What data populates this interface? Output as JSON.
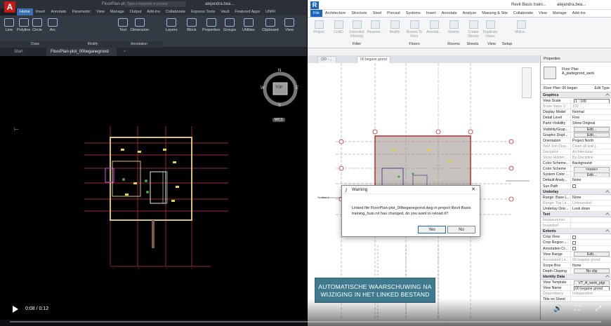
{
  "autocad": {
    "logo": "A",
    "filename": "FloorPlan-pl...",
    "search_placeholder": "Type a keyword or phrase",
    "user": "alejandra.bea...",
    "tabs": [
      "Home",
      "Insert",
      "Annotate",
      "Parametric",
      "View",
      "Manage",
      "Output",
      "Add-ins",
      "Collaborate",
      "Express Tools",
      "Vault",
      "Featured Apps",
      "UNIFI"
    ],
    "ribbon_tools": [
      "Line",
      "Polyline",
      "Circle",
      "Arc",
      "Text",
      "Dimension",
      "Layers",
      "Block",
      "Properties",
      "Groups",
      "Utilities",
      "Clipboard",
      "View"
    ],
    "ribbon_groups": [
      "Draw",
      "Modify",
      "Annotation"
    ],
    "doc_tabs": [
      "Start",
      "FloorPlan-plot_00beganegrond"
    ],
    "viewcube": {
      "top": "TOP",
      "n": "N",
      "s": "S",
      "e": "E",
      "w": "W"
    },
    "wcs": "WCS"
  },
  "revit": {
    "logo": "R",
    "title": "Revit Basis traini...",
    "user": "alejandra.bea...",
    "tabs": [
      "File",
      "Architecture",
      "Structure",
      "Steel",
      "Precast",
      "Systems",
      "Insert",
      "Annotate",
      "Analyze",
      "Massing & Site",
      "Collaborate",
      "View",
      "Manage",
      "Add-Ins"
    ],
    "ribbon_buttons": [
      "Project",
      "CoilID",
      "Extended Filtering",
      "Paramet...",
      "Modify",
      "Rooms To Floor",
      "Annotat...",
      "Rooms",
      "Create Sheets",
      "Duplicate Views",
      "Midco..."
    ],
    "ribbon_groups": [
      "Filter",
      "Floors",
      "Rooms",
      "Sheets",
      "View",
      "Setup"
    ],
    "doc_tabs": [
      "{3D - ...",
      "00 begane grond"
    ],
    "section_label": "Section 1",
    "properties": {
      "header": "Properties",
      "type_name": "Floor Plan",
      "type_sub": "A_plattegrond_werk",
      "selector": "Floor Plan: 00 began",
      "edit_type": "Edit Type",
      "sections": [
        {
          "name": "Graphics",
          "rows": [
            {
              "k": "View Scale",
              "v": "1 : 100",
              "t": "inp"
            },
            {
              "k": "Scale Value    1:",
              "v": "100",
              "t": "grey"
            },
            {
              "k": "Display Model",
              "v": "Normal",
              "t": ""
            },
            {
              "k": "Detail Level",
              "v": "Fine",
              "t": ""
            },
            {
              "k": "Parts Visibility",
              "v": "Show Original",
              "t": ""
            },
            {
              "k": "Visibility/Grap...",
              "v": "Edit...",
              "t": "btn"
            },
            {
              "k": "Graphic Displ...",
              "v": "Edit...",
              "t": "btn"
            },
            {
              "k": "Orientation",
              "v": "Project North",
              "t": ""
            },
            {
              "k": "Wall Join Disp...",
              "v": "Clean all wall j...",
              "t": "grey"
            },
            {
              "k": "Discipline",
              "v": "Architectural",
              "t": "grey"
            },
            {
              "k": "Show Hidden ...",
              "v": "By Discipline",
              "t": "grey"
            },
            {
              "k": "Color Scheme...",
              "v": "Background",
              "t": ""
            },
            {
              "k": "Color Scheme",
              "v": "<none>",
              "t": "btn"
            },
            {
              "k": "System Color ...",
              "v": "Edit...",
              "t": "btn"
            },
            {
              "k": "Default Analy...",
              "v": "None",
              "t": ""
            },
            {
              "k": "Sun Path",
              "v": "",
              "t": "chk"
            }
          ]
        },
        {
          "name": "Underlay",
          "rows": [
            {
              "k": "Range: Base L...",
              "v": "None",
              "t": ""
            },
            {
              "k": "Range: Top Le...",
              "v": "Unbounded",
              "t": "grey"
            },
            {
              "k": "Underlay Orie...",
              "v": "Look down",
              "t": ""
            }
          ]
        },
        {
          "name": "Text",
          "rows": [
            {
              "k": "bouwnummer",
              "v": "",
              "t": "grey"
            },
            {
              "k": "bouwdeel",
              "v": "",
              "t": "grey"
            }
          ]
        },
        {
          "name": "Extents",
          "rows": [
            {
              "k": "Crop View",
              "v": "",
              "t": "chk"
            },
            {
              "k": "Crop Region ...",
              "v": "",
              "t": "chk"
            },
            {
              "k": "Annotation Cr...",
              "v": "",
              "t": "chk"
            },
            {
              "k": "View Range",
              "v": "Edit...",
              "t": "btn"
            },
            {
              "k": "Associated Le...",
              "v": "00 begane grond",
              "t": "grey"
            },
            {
              "k": "Scope Box",
              "v": "None",
              "t": ""
            },
            {
              "k": "Depth Clipping",
              "v": "No clip",
              "t": "btn"
            }
          ]
        },
        {
          "name": "Identity Data",
          "rows": [
            {
              "k": "View Template",
              "v": "VT_A_werk_plgr",
              "t": "btn"
            },
            {
              "k": "View Name",
              "v": "00 begane grond",
              "t": "inp"
            },
            {
              "k": "Dependency",
              "v": "Independent",
              "t": "grey"
            },
            {
              "k": "Title on Sheet",
              "v": "",
              "t": ""
            }
          ]
        }
      ]
    }
  },
  "dialog": {
    "title": "Warning",
    "message": "Linked file FloorPlan-plot_00beganegrond.dwg in project Revit Basis training_huis.rvt has changed, do you want to reload it?",
    "yes": "Yes",
    "no": "No"
  },
  "caption": {
    "line1": "AUTOMATISCHE WAARSCHUWING NA",
    "line2": "WIJZIGING IN HET LINKED BESTAND"
  },
  "video": {
    "time": "0:08 / 0:12",
    "progress": 0.0
  }
}
